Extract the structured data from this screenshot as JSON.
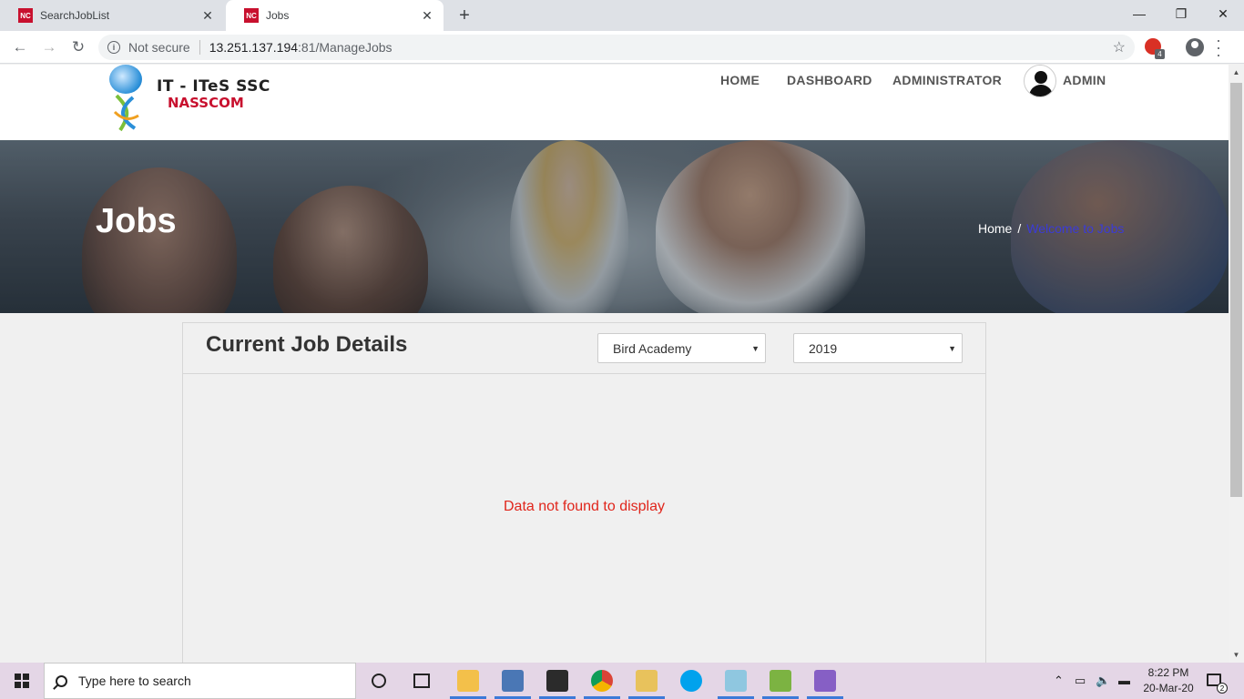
{
  "browser": {
    "tabs": [
      {
        "favicon": "NC",
        "title": "SearchJobList",
        "close": "✕"
      },
      {
        "favicon": "NC",
        "title": "Jobs",
        "close": "✕"
      }
    ],
    "new_tab": "+",
    "window_controls": {
      "minimize": "—",
      "maximize": "❐",
      "close": "✕"
    },
    "security_label": "Not secure",
    "url_host": "13.251.137.194",
    "url_rest": ":81/ManageJobs",
    "extension_badge": "4"
  },
  "site": {
    "logo_title": "IT - ITeS SSC",
    "logo_subtitle": "NASSCOM",
    "nav": {
      "home": "HOME",
      "dashboard": "DASHBOARD",
      "administrator": "ADMINISTRATOR",
      "admin": "ADMIN"
    }
  },
  "hero": {
    "title": "Jobs",
    "breadcrumb_home": "Home",
    "breadcrumb_sep": "/",
    "breadcrumb_current": "Welcome to Jobs"
  },
  "panel": {
    "title": "Current Job Details",
    "academy_select": "Bird Academy",
    "year_select": "2019",
    "empty_message": "Data not found to display"
  },
  "taskbar": {
    "search_placeholder": "Type here to search",
    "time": "8:22 PM",
    "date": "20-Mar-20",
    "notification_count": "2"
  },
  "colors": {
    "empty_message": "#e0251b",
    "breadcrumb_current": "#3b3bd6",
    "brand_red": "#c8102e"
  }
}
